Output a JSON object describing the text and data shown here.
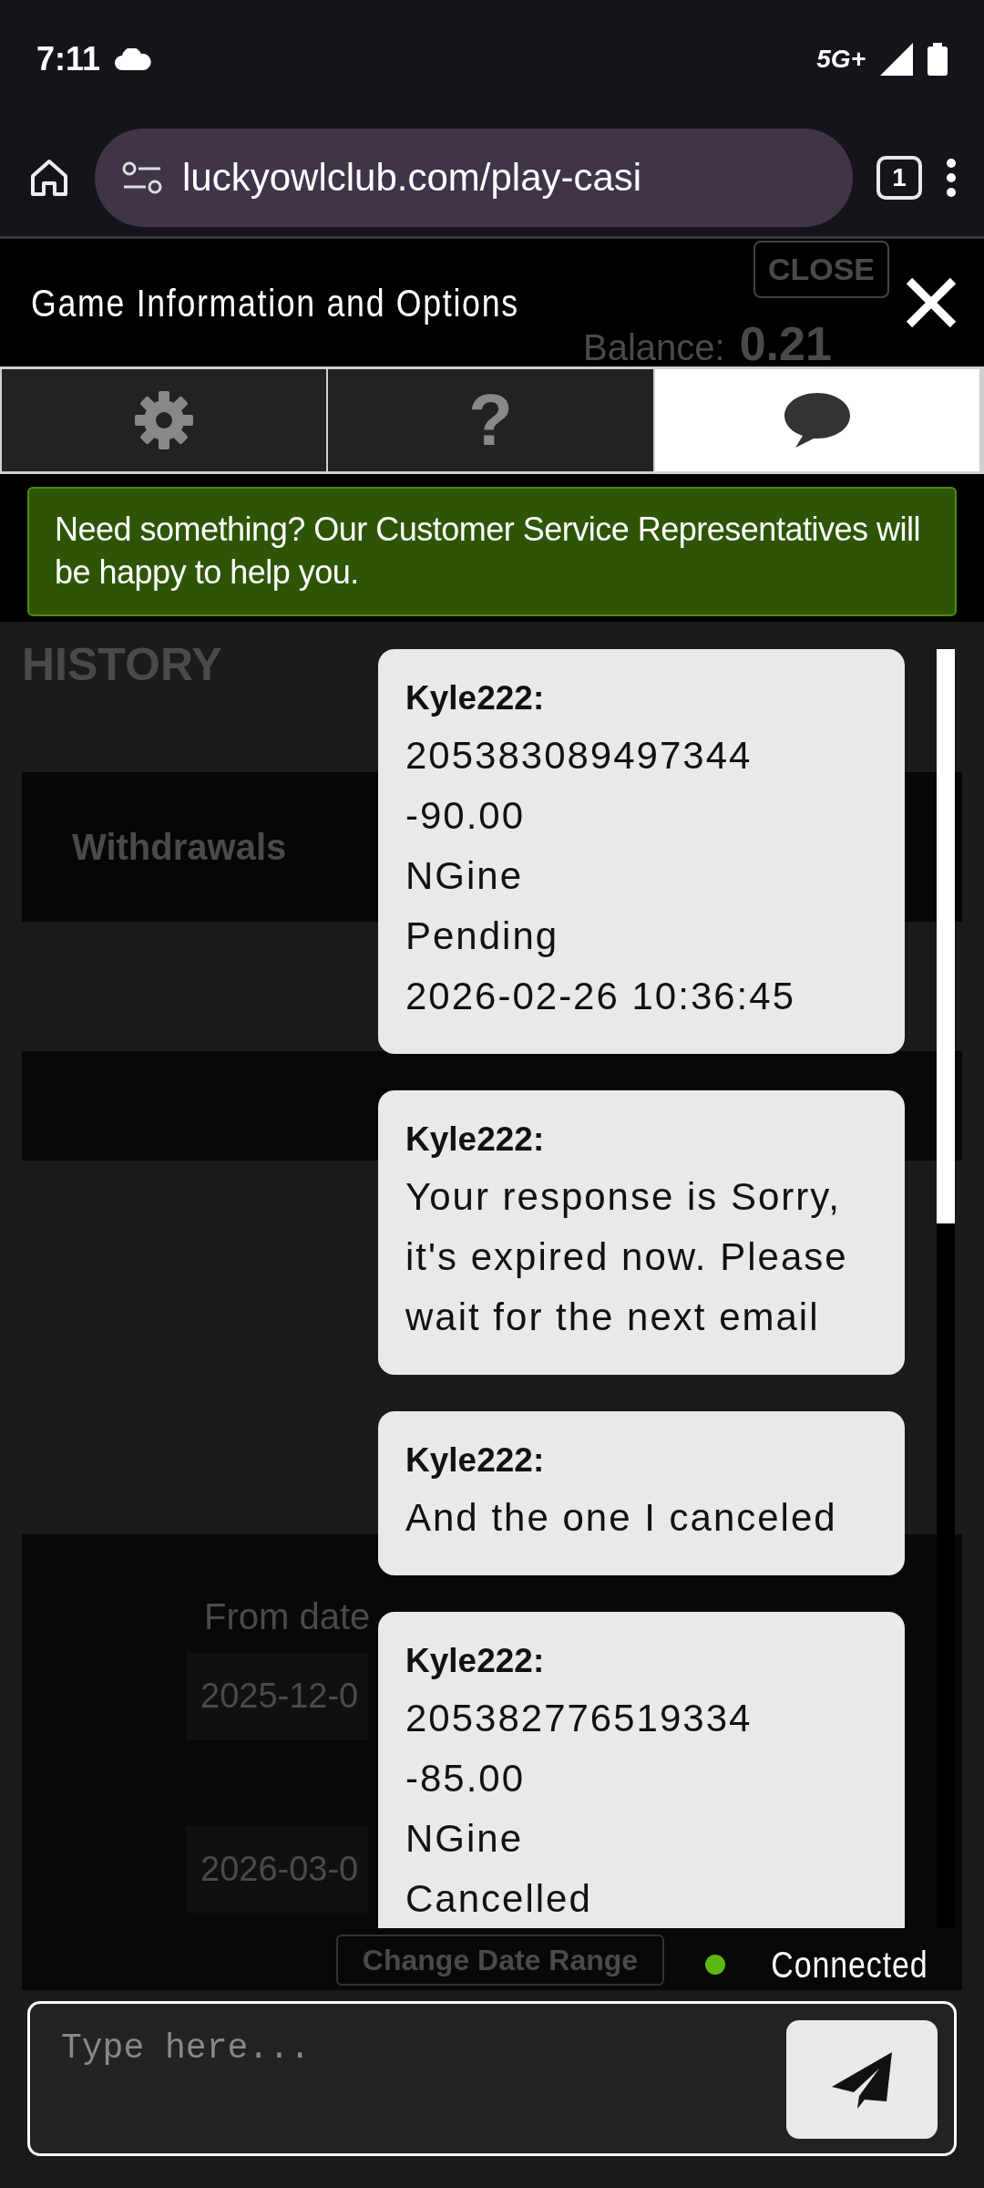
{
  "status_bar": {
    "time": "7:11",
    "network": "5G+"
  },
  "browser": {
    "url": "luckyowlclub.com/play-casi",
    "tab_count": "1"
  },
  "background_page": {
    "close_button": "CLOSE",
    "balance_label": "Balance:",
    "balance_value": "0.21",
    "heading": "HISTORY",
    "tab_label": "Withdrawals",
    "from_date_label": "From date",
    "from_date": "2025-12-0",
    "to_date": "2026-03-0",
    "change_button": "Change Date Range"
  },
  "dialog": {
    "title": "Game Information and Options",
    "tabs": [
      {
        "kind": "gear",
        "selected": false
      },
      {
        "kind": "text",
        "label": "?",
        "selected": false
      },
      {
        "kind": "bubble",
        "selected": true
      }
    ],
    "notice": "Need something? Our Customer Service Representatives will be happy to help you.",
    "messages": [
      {
        "sender": "Kyle222:",
        "lines": [
          "205383089497344",
          "-90.00",
          "NGine",
          "Pending",
          "2026-02-26 10:36:45"
        ]
      },
      {
        "sender": "Kyle222:",
        "lines": [
          "Your response is Sorry, it's expired now. Please wait for the next email"
        ]
      },
      {
        "sender": "Kyle222:",
        "lines": [
          "And the one I canceled"
        ]
      },
      {
        "sender": "Kyle222:",
        "lines": [
          "205382776519334",
          "-85.00",
          "NGine",
          "Cancelled"
        ]
      }
    ],
    "connection": {
      "label": "Connected",
      "connected": true
    },
    "input": {
      "placeholder": "Type here..."
    }
  }
}
